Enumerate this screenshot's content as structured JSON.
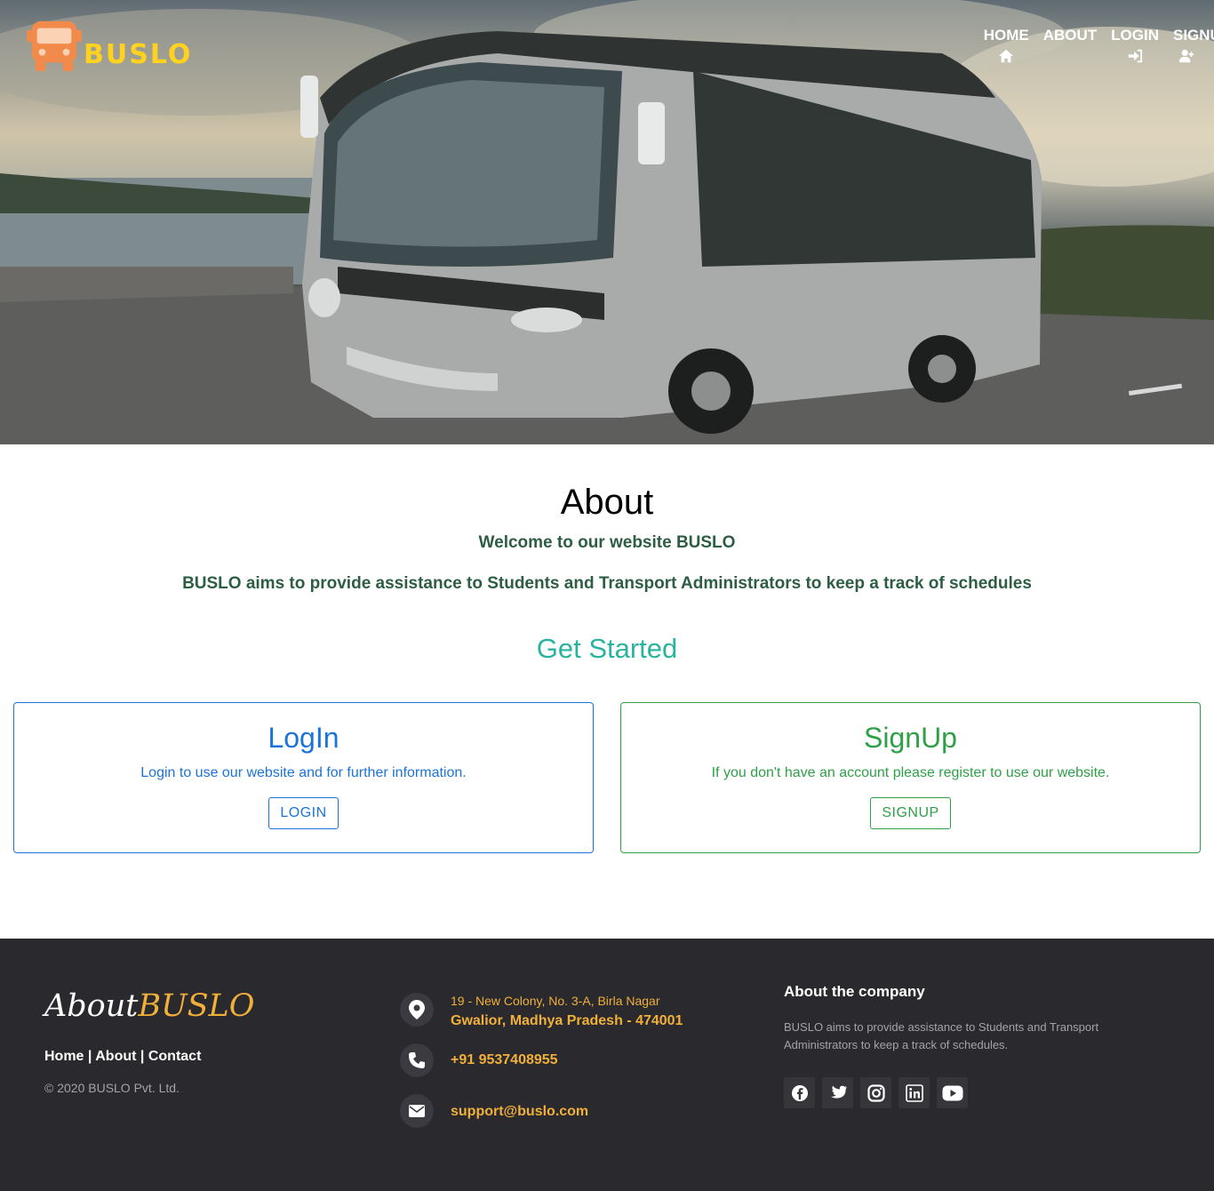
{
  "brand": {
    "name": "BUSLO",
    "accent": "#ffd21f",
    "icon": "bus-icon"
  },
  "nav": [
    {
      "label": "HOME",
      "icon": "home-icon"
    },
    {
      "label": "ABOUT",
      "icon": ""
    },
    {
      "label": "LOGIN",
      "icon": "sign-in-icon"
    },
    {
      "label": "SIGNUP",
      "icon": "user-plus-icon"
    }
  ],
  "about": {
    "title": "About",
    "welcome": "Welcome to our website BUSLO",
    "aim": "BUSLO aims to provide assistance to Students and Transport Administrators to keep a track of schedules",
    "get_started": "Get Started"
  },
  "cards": {
    "login": {
      "title": "LogIn",
      "text": "Login to use our website and for further information.",
      "button": "LOGIN",
      "color": "#1c73d9"
    },
    "signup": {
      "title": "SignUp",
      "text": "If you don't have an account please register to use our website.",
      "button": "SIGNUP",
      "color": "#2fa047"
    }
  },
  "footer": {
    "brand_white": "About",
    "brand_yellow": "BUSLO",
    "links": {
      "home": "Home",
      "about": "About",
      "contact": "Contact",
      "separator": "|"
    },
    "copyright": "© 2020 BUSLO Pvt. Ltd.",
    "address_line1": "19 - New Colony, No. 3-A, Birla Nagar",
    "address_line2": "Gwalior, Madhya Pradesh - 474001",
    "phone": "+91 9537408955",
    "email": "support@buslo.com",
    "company_title": "About the company",
    "company_text": "BUSLO aims to provide assistance to Students and Transport Administrators to keep a track of schedules.",
    "socials": [
      "facebook-icon",
      "twitter-icon",
      "instagram-icon",
      "linkedin-icon",
      "youtube-icon"
    ],
    "accent": "#f0b03a",
    "background": "#2a292e"
  }
}
